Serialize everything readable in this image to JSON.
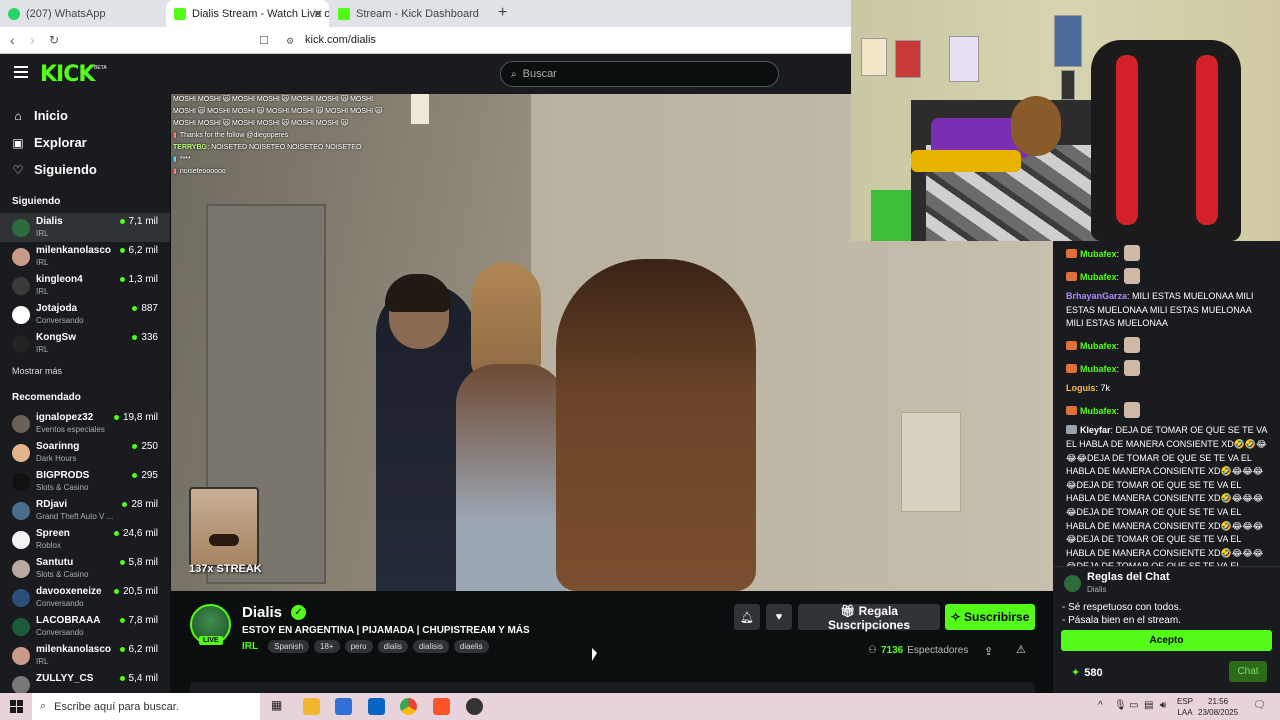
{
  "browser": {
    "tabs": [
      {
        "title": "(207) WhatsApp",
        "active": false
      },
      {
        "title": "Dialis Stream - Watch Live o",
        "active": true
      },
      {
        "title": "Stream - Kick Dashboard",
        "active": false
      }
    ],
    "new_tab_label": "+",
    "url": "kick.com/dialis"
  },
  "header": {
    "logo": "KICK",
    "logo_badge": "BETA",
    "search_placeholder": "Buscar"
  },
  "sidebar": {
    "nav": [
      {
        "label": "Inicio",
        "icon": "home-icon"
      },
      {
        "label": "Explorar",
        "icon": "compass-icon"
      },
      {
        "label": "Siguiendo",
        "icon": "heart-icon"
      }
    ],
    "following_heading": "Siguiendo",
    "following": [
      {
        "name": "Dialis",
        "category": "IRL",
        "viewers": "7,1 mil",
        "avatar_color": "#2d6b3a"
      },
      {
        "name": "milenkanolasco",
        "category": "IRL",
        "viewers": "6,2 mil",
        "avatar_color": "#c79b87"
      },
      {
        "name": "kingleon4",
        "category": "IRL",
        "viewers": "1,3 mil",
        "avatar_color": "#3a3a3a"
      },
      {
        "name": "Jotajoda",
        "category": "Conversando",
        "viewers": "887",
        "avatar_color": "#ffffff"
      },
      {
        "name": "KongSw",
        "category": "IRL",
        "viewers": "336",
        "avatar_color": "#222222"
      }
    ],
    "show_more": "Mostrar más",
    "recommended_heading": "Recomendado",
    "recommended": [
      {
        "name": "ignalopez32",
        "category": "Eventos especiales",
        "viewers": "19,8 mil",
        "avatar_color": "#6b5f58"
      },
      {
        "name": "Soarinng",
        "category": "Dark Hours",
        "viewers": "250",
        "avatar_color": "#e1b48a"
      },
      {
        "name": "BIGPRODS",
        "category": "Slots & Casino",
        "viewers": "295",
        "avatar_color": "#111111"
      },
      {
        "name": "RDjavi",
        "category": "Grand Theft Auto V ...",
        "viewers": "28 mil",
        "avatar_color": "#4a6d8c"
      },
      {
        "name": "Spreen",
        "category": "Roblox",
        "viewers": "24,6 mil",
        "avatar_color": "#f2f2f2"
      },
      {
        "name": "Santutu",
        "category": "Slots & Casino",
        "viewers": "5,8 mil",
        "avatar_color": "#b8a8a0"
      },
      {
        "name": "davooxeneize",
        "category": "Conversando",
        "viewers": "20,5 mil",
        "avatar_color": "#2a4f7a"
      },
      {
        "name": "LACOBRAAA",
        "category": "Conversando",
        "viewers": "7,8 mil",
        "avatar_color": "#1d5a3a"
      },
      {
        "name": "milenkanolasco",
        "category": "IRL",
        "viewers": "6,2 mil",
        "avatar_color": "#c79b87"
      },
      {
        "name": "ZULLYY_CS",
        "category": "",
        "viewers": "5,4 mil",
        "avatar_color": "#777777"
      }
    ]
  },
  "video": {
    "overlay_chat": [
      {
        "user": "",
        "text": "MOSHI MOSHI 🙀 MOSHI MOSHI 🙀 MOSHI MOSHI 🙀 MOSHI MOSHI 🙀 MOSHI MOSHI 🙀 MOSHI MOSHI 🙀 MOSHI MOSHI 🙀 MOSHI MOSHI 🙀 MOSHI MOSHI 🙀 MOSHI MOSHI 🙀"
      },
      {
        "user": "",
        "text": "Thanks for the follow @diegoperes"
      },
      {
        "user": "TERRYBG:",
        "text": "NOISETED NOISETEO NOISETEO NOISETEO"
      },
      {
        "user": "",
        "text": "****"
      },
      {
        "user": "",
        "text": "noiseteoooooo"
      }
    ],
    "streak_text": "137x STREAK"
  },
  "chat": {
    "messages": [
      {
        "user": "Mubafex",
        "color": "#53fc18",
        "text": "",
        "badge": true,
        "emote": true
      },
      {
        "user": "Mubafex",
        "color": "#53fc18",
        "text": "",
        "badge": true,
        "emote": true
      },
      {
        "user": "BrhayanGarza",
        "color": "#b388ff",
        "text": "MILI ESTAS MUELONAA MILI ESTAS MUELONAA MILI ESTAS MUELONAA MILI ESTAS MUELONAA",
        "badge": false,
        "emote": false
      },
      {
        "user": "Mubafex",
        "color": "#53fc18",
        "text": "",
        "badge": true,
        "emote": true
      },
      {
        "user": "Mubafex",
        "color": "#53fc18",
        "text": "",
        "badge": true,
        "emote": true
      },
      {
        "user": "Loguis",
        "color": "#ffb84d",
        "text": "7k",
        "badge": false,
        "emote": false
      },
      {
        "user": "Mubafex",
        "color": "#53fc18",
        "text": "",
        "badge": true,
        "emote": true
      },
      {
        "user": "Kleyfar",
        "color": "#ffffff",
        "text": "DEJA DE TOMAR OE QUE SE TE VA EL HABLA DE MANERA CONSIENTE XD🤣🤣😂😂😂DEJA DE TOMAR OE QUE SE TE VA EL HABLA DE MANERA CONSIENTE XD🤣😂😂😂😂DEJA DE TOMAR OE QUE SE TE VA EL HABLA DE MANERA CONSIENTE XD🤣😂😂😂😂DEJA DE TOMAR OE QUE SE TE VA EL HABLA DE MANERA CONSIENTE XD🤣😂😂😂😂DEJA DE TOMAR OE QUE SE TE VA EL HABLA DE MANERA CONSIENTE XD🤣😂😂😂😂DEJA DE TOMAR OE QUE SE TE VA EL",
        "badge": true,
        "emote": false
      }
    ],
    "rules": {
      "title": "Reglas del Chat",
      "channel": "Dialis",
      "rule1": "- Sé respetuoso con todos.",
      "rule2": "- Pásala bien en el stream.",
      "accept_label": "Acepto"
    },
    "points": "580",
    "chat_button": "Chat"
  },
  "stream": {
    "name": "Dialis",
    "title": "ESTOY EN ARGENTINA | PIJAMADA | CHUPISTREAM Y MÁS",
    "live_badge": "LIVE",
    "category": "IRL",
    "tags": [
      "Spanish",
      "18+",
      "peru",
      "dialis",
      "dialisis",
      "diaelis"
    ],
    "gift_label": "Regala Suscripciones",
    "subscribe_label": "Suscribirse",
    "viewers_count": "7136",
    "viewers_label": "Espectadores"
  },
  "taskbar": {
    "search_placeholder": "Escribe aquí para buscar.",
    "lang_top": "ESP",
    "lang_bottom": "LAA",
    "time": "21:56",
    "date": "23/08/2025"
  }
}
